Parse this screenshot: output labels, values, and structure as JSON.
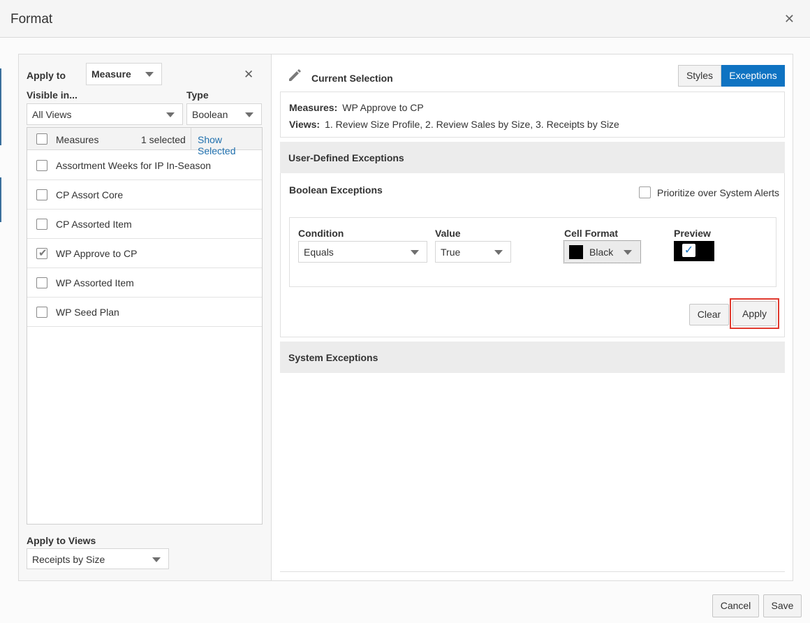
{
  "dialog": {
    "title": "Format"
  },
  "left": {
    "apply_to_label": "Apply to",
    "apply_to_value": "Measure",
    "visible_in_label": "Visible in...",
    "visible_in_value": "All Views",
    "type_label": "Type",
    "type_value": "Boolean",
    "measures_header": "Measures",
    "selected_count": "1 selected",
    "show_selected": "Show Selected",
    "measures": [
      {
        "label": "Assortment Weeks for IP In-Season",
        "checked": false
      },
      {
        "label": "CP Assort Core",
        "checked": false
      },
      {
        "label": "CP Assorted Item",
        "checked": false
      },
      {
        "label": "WP Approve to CP",
        "checked": true
      },
      {
        "label": "WP Assorted Item",
        "checked": false
      },
      {
        "label": "WP Seed Plan",
        "checked": false
      }
    ],
    "apply_to_views_label": "Apply to Views",
    "apply_to_views_value": "Receipts by Size"
  },
  "right": {
    "current_selection": "Current Selection",
    "tabs": {
      "styles": "Styles",
      "exceptions": "Exceptions"
    },
    "measures_label": "Measures:",
    "measures_value": "WP Approve to CP",
    "views_label": "Views:",
    "views_value": "1. Review Size Profile, 2. Review Sales by Size, 3. Receipts by Size",
    "user_defined_title": "User-Defined Exceptions",
    "boolean_title": "Boolean Exceptions",
    "prioritize_label": "Prioritize over System Alerts",
    "condition_label": "Condition",
    "condition_value": "Equals",
    "value_label": "Value",
    "value_value": "True",
    "cell_format_label": "Cell Format",
    "cell_format_value": "Black",
    "cell_format_color": "#000000",
    "preview_label": "Preview",
    "clear_label": "Clear",
    "apply_label": "Apply",
    "system_title": "System Exceptions"
  },
  "footer": {
    "cancel": "Cancel",
    "save": "Save"
  },
  "colors": {
    "accent": "#0f73c2",
    "highlight": "#e0392e"
  }
}
